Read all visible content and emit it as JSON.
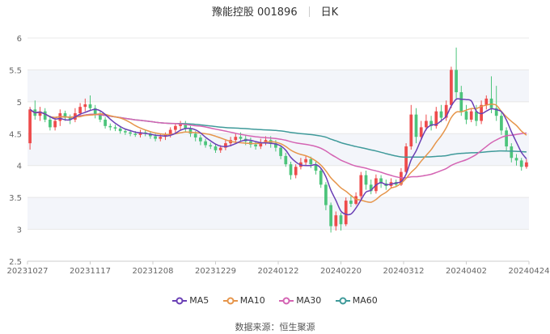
{
  "header": {
    "stock_name": "豫能控股 001896",
    "period": "日K"
  },
  "source": {
    "label": "数据来源：",
    "name": "恒生聚源"
  },
  "colors": {
    "up": "#ee4b4b",
    "down": "#4cc47b",
    "MA5": "#6a3fb5",
    "MA10": "#e6954a",
    "MA30": "#d464b3",
    "MA60": "#3f9a9a",
    "grid": "#e8e8e8",
    "band": "#f3f5fa",
    "axis": "#999999"
  },
  "chart_data": {
    "type": "candlestick",
    "title": "豫能控股 001896",
    "ylim": [
      2.5,
      6
    ],
    "yticks": [
      "2.5",
      "3",
      "3.5",
      "4",
      "4.5",
      "5",
      "5.5",
      "6"
    ],
    "x_tick_labels": [
      "20231027",
      "20231117",
      "20231208",
      "20231229",
      "20240122",
      "20240220",
      "20240312",
      "20240402",
      "20240424"
    ],
    "legend": [
      "MA5",
      "MA10",
      "MA30",
      "MA60"
    ],
    "candles": [
      [
        4.35,
        4.88,
        4.25,
        4.92
      ],
      [
        4.88,
        4.78,
        4.72,
        5.02
      ],
      [
        4.78,
        4.85,
        4.7,
        4.92
      ],
      [
        4.85,
        4.72,
        4.68,
        4.9
      ],
      [
        4.72,
        4.6,
        4.55,
        4.78
      ],
      [
        4.6,
        4.7,
        4.55,
        4.75
      ],
      [
        4.7,
        4.82,
        4.62,
        4.88
      ],
      [
        4.82,
        4.75,
        4.7,
        4.86
      ],
      [
        4.75,
        4.72,
        4.65,
        4.8
      ],
      [
        4.72,
        4.82,
        4.68,
        4.9
      ],
      [
        4.82,
        4.92,
        4.78,
        4.98
      ],
      [
        4.92,
        4.96,
        4.85,
        5.05
      ],
      [
        4.96,
        4.9,
        4.86,
        5.1
      ],
      [
        4.9,
        4.8,
        4.74,
        4.95
      ],
      [
        4.8,
        4.72,
        4.68,
        4.85
      ],
      [
        4.72,
        4.62,
        4.58,
        4.76
      ],
      [
        4.62,
        4.6,
        4.55,
        4.66
      ],
      [
        4.6,
        4.58,
        4.54,
        4.64
      ],
      [
        4.58,
        4.54,
        4.5,
        4.62
      ],
      [
        4.54,
        4.52,
        4.48,
        4.58
      ],
      [
        4.52,
        4.5,
        4.46,
        4.56
      ],
      [
        4.5,
        4.48,
        4.45,
        4.54
      ],
      [
        4.48,
        4.52,
        4.44,
        4.56
      ],
      [
        4.52,
        4.5,
        4.46,
        4.56
      ],
      [
        4.5,
        4.46,
        4.42,
        4.54
      ],
      [
        4.46,
        4.42,
        4.38,
        4.5
      ],
      [
        4.42,
        4.45,
        4.38,
        4.5
      ],
      [
        4.45,
        4.48,
        4.4,
        4.52
      ],
      [
        4.48,
        4.56,
        4.44,
        4.6
      ],
      [
        4.56,
        4.62,
        4.5,
        4.66
      ],
      [
        4.62,
        4.66,
        4.55,
        4.7
      ],
      [
        4.66,
        4.58,
        4.52,
        4.7
      ],
      [
        4.58,
        4.5,
        4.45,
        4.62
      ],
      [
        4.5,
        4.44,
        4.38,
        4.54
      ],
      [
        4.44,
        4.38,
        4.32,
        4.48
      ],
      [
        4.38,
        4.32,
        4.28,
        4.42
      ],
      [
        4.32,
        4.3,
        4.26,
        4.36
      ],
      [
        4.3,
        4.24,
        4.2,
        4.34
      ],
      [
        4.24,
        4.28,
        4.2,
        4.32
      ],
      [
        4.28,
        4.35,
        4.24,
        4.4
      ],
      [
        4.35,
        4.4,
        4.3,
        4.45
      ],
      [
        4.4,
        4.45,
        4.35,
        4.5
      ],
      [
        4.45,
        4.42,
        4.38,
        4.52
      ],
      [
        4.42,
        4.38,
        4.32,
        4.48
      ],
      [
        4.38,
        4.33,
        4.28,
        4.44
      ],
      [
        4.33,
        4.3,
        4.25,
        4.38
      ],
      [
        4.3,
        4.36,
        4.26,
        4.42
      ],
      [
        4.36,
        4.4,
        4.32,
        4.46
      ],
      [
        4.4,
        4.35,
        4.28,
        4.46
      ],
      [
        4.35,
        4.28,
        4.22,
        4.4
      ],
      [
        4.28,
        4.15,
        4.1,
        4.32
      ],
      [
        4.15,
        4.02,
        3.98,
        4.2
      ],
      [
        4.02,
        3.85,
        3.78,
        4.06
      ],
      [
        3.85,
        3.98,
        3.8,
        4.02
      ],
      [
        3.98,
        4.05,
        3.94,
        4.12
      ],
      [
        4.05,
        4.1,
        4.0,
        4.16
      ],
      [
        4.1,
        4.02,
        3.96,
        4.14
      ],
      [
        4.02,
        3.92,
        3.86,
        4.06
      ],
      [
        3.92,
        3.7,
        3.65,
        3.96
      ],
      [
        3.7,
        3.38,
        3.3,
        3.74
      ],
      [
        3.38,
        3.05,
        2.95,
        3.42
      ],
      [
        3.05,
        3.22,
        2.98,
        3.28
      ],
      [
        3.22,
        3.08,
        2.98,
        3.26
      ],
      [
        3.08,
        3.45,
        3.05,
        3.5
      ],
      [
        3.45,
        3.4,
        3.35,
        3.52
      ],
      [
        3.4,
        3.52,
        3.38,
        3.58
      ],
      [
        3.52,
        3.85,
        3.48,
        3.9
      ],
      [
        3.85,
        3.7,
        3.62,
        3.92
      ],
      [
        3.7,
        3.6,
        3.55,
        3.78
      ],
      [
        3.6,
        3.8,
        3.56,
        3.86
      ],
      [
        3.8,
        3.72,
        3.65,
        3.85
      ],
      [
        3.72,
        3.68,
        3.62,
        3.78
      ],
      [
        3.68,
        3.74,
        3.64,
        3.8
      ],
      [
        3.74,
        3.7,
        3.66,
        3.78
      ],
      [
        3.7,
        3.9,
        3.68,
        3.96
      ],
      [
        3.9,
        4.3,
        3.88,
        4.35
      ],
      [
        4.3,
        4.8,
        4.25,
        4.95
      ],
      [
        4.8,
        4.45,
        4.35,
        4.9
      ],
      [
        4.45,
        4.6,
        4.4,
        4.7
      ],
      [
        4.6,
        4.7,
        4.55,
        4.8
      ],
      [
        4.7,
        4.62,
        4.55,
        4.78
      ],
      [
        4.62,
        4.85,
        4.58,
        4.92
      ],
      [
        4.85,
        4.75,
        4.68,
        4.95
      ],
      [
        4.75,
        4.95,
        4.7,
        5.02
      ],
      [
        4.95,
        5.5,
        4.9,
        5.55
      ],
      [
        5.5,
        5.15,
        5.05,
        5.85
      ],
      [
        5.15,
        4.85,
        4.78,
        5.25
      ],
      [
        4.85,
        4.72,
        4.65,
        4.95
      ],
      [
        4.72,
        4.85,
        4.68,
        4.9
      ],
      [
        4.85,
        4.7,
        4.62,
        4.95
      ],
      [
        4.7,
        4.95,
        4.65,
        5.02
      ],
      [
        4.95,
        5.05,
        4.88,
        5.1
      ],
      [
        5.05,
        4.9,
        4.82,
        5.4
      ],
      [
        4.9,
        4.78,
        4.7,
        5.25
      ],
      [
        4.78,
        4.55,
        4.48,
        4.85
      ],
      [
        4.55,
        4.3,
        4.22,
        4.6
      ],
      [
        4.3,
        4.12,
        4.05,
        4.35
      ],
      [
        4.12,
        4.08,
        4.0,
        4.18
      ],
      [
        4.08,
        3.98,
        3.92,
        4.12
      ],
      [
        3.98,
        4.05,
        3.95,
        4.1
      ]
    ]
  }
}
